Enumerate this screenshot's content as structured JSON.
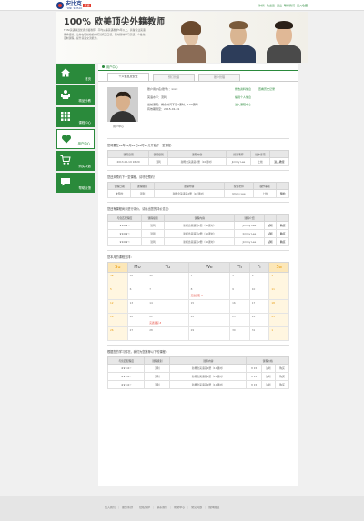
{
  "header": {
    "logo_text": "安比克",
    "logo_sub": "TONI SPEAK",
    "logo_tag": "英语",
    "links": [
      "你好！欢迎您",
      "退出",
      "联系我们",
      "加入收藏"
    ]
  },
  "banner": {
    "title": "100% 欧美顶尖外籍教师",
    "desc": "TONI英语精选优秀外籍教师，平均从事英语教学5年以上，具备专业英语教学经验，让你在轻松愉悦中练就纯正口语，随时随地学习英语，个性化定制课程，提升英语交流能力。"
  },
  "sidebar": {
    "items": [
      {
        "label": "首页",
        "icon": "home-icon"
      },
      {
        "label": "精品外教",
        "icon": "teacher-icon"
      },
      {
        "label": "课程中心",
        "icon": "grid-icon"
      },
      {
        "label": "用户中心",
        "icon": "heart-icon"
      },
      {
        "label": "购买次数",
        "icon": "cart-icon"
      },
      {
        "label": "帮助反馈",
        "icon": "chat-icon"
      }
    ]
  },
  "content": {
    "heading": "用户中心",
    "tabs": [
      "个人信息及安全",
      "预订管理",
      "账户管理"
    ],
    "profile": {
      "name_label": "用户中心",
      "account": "账户用户名(账号)：xxxx",
      "points": "英语水平：流利",
      "balance": "当前课程：剩余时间不足2课时，100课时",
      "balance_sub": "有效期限至：2015-01-01",
      "links": [
        "修改资料信息",
        "查看历史记录",
        "编辑个人信息",
        "进入课程中心"
      ]
    },
    "upcoming": {
      "title": "您将要在xx年xx月xx日xx时xx分开始下一堂课程：",
      "headers": [
        "课程日期",
        "课程级别",
        "课程内容",
        "授课老师",
        "操作事项",
        ""
      ],
      "rows": [
        [
          "2013-05-19  18:20",
          "流利",
          "新概念英语第2册（10课时）",
          "Jimmy Lee",
          "上线",
          "进入教室"
        ]
      ]
    },
    "history": {
      "title": "您还未预约下一堂课程，请尽快预约！",
      "headers": [
        "课程日期",
        "课程级别",
        "课程内容",
        "授课老师",
        "操作事项",
        ""
      ],
      "rows": [
        [
          "未预约",
          "流利",
          "新概念英语第2册（10课时）",
          "Jimmy Lee",
          "上线",
          "预约"
        ]
      ]
    },
    "rating": {
      "title": "您还有课程尚未进行评价，请给出您的评价意见：",
      "headers": [
        "与您匹配程度",
        "课程级别",
        "课程内容",
        "课程介绍",
        "",
        ""
      ],
      "rows": [
        [
          "★★★★☆",
          "流利",
          "新概念英语第2册（10课时）",
          "Jimmy Lee",
          "试听",
          "购买"
        ],
        [
          "★★★★☆",
          "流利",
          "新概念英语第2册（10课时）",
          "Jimmy Lee",
          "试听",
          "购买"
        ],
        [
          "★★★★☆",
          "流利",
          "新概念英语第2册（10课时）",
          "Jimmy Lee",
          "试听",
          "购买"
        ]
      ]
    },
    "calendar": {
      "title": "您本月的课程安排：",
      "days": [
        "Su",
        "Mo",
        "Tu",
        "We",
        "Th",
        "Fr",
        "Sa"
      ],
      "weeks": [
        [
          "28",
          "29",
          "30",
          "1",
          "2",
          "3",
          "4"
        ],
        [
          "5",
          "6",
          "7",
          "8",
          "9",
          "10",
          "11"
        ],
        [
          "12",
          "13",
          "14",
          "15",
          "16",
          "17",
          "18"
        ],
        [
          "19",
          "20",
          "21",
          "22",
          "23",
          "24",
          "25"
        ],
        [
          "26",
          "27",
          "28",
          "29",
          "30",
          "31",
          "1"
        ]
      ],
      "events": {
        "1-3": "英语课程-2",
        "3-2": "英语课程-3"
      }
    },
    "recommend": {
      "title": "根据您的学习情况，我们为您推荐以下的课程：",
      "headers": [
        "与您匹配程度",
        "课程级别",
        "课程内容",
        "课程价格"
      ],
      "rows": [
        [
          "★★★★☆",
          "流利",
          "新概念英语第2册（10课时）",
          "¥ 15",
          "试听",
          "购买"
        ],
        [
          "★★★★☆",
          "流利",
          "新概念英语第2册（10课时）",
          "¥ 15",
          "试听",
          "购买"
        ],
        [
          "★★★★☆",
          "流利",
          "新概念英语第2册（10课时）",
          "¥ 15",
          "试听",
          "购买"
        ]
      ]
    }
  },
  "footer": {
    "links": [
      "加入我们",
      "服务条款",
      "隐私保护",
      "联系我们",
      "帮助中心",
      "常见问题",
      "媒体报道"
    ]
  },
  "colors": {
    "brand_green": "#2a8a3b",
    "accent_orange": "#e89b0b",
    "accent_red": "#e23b2e"
  }
}
